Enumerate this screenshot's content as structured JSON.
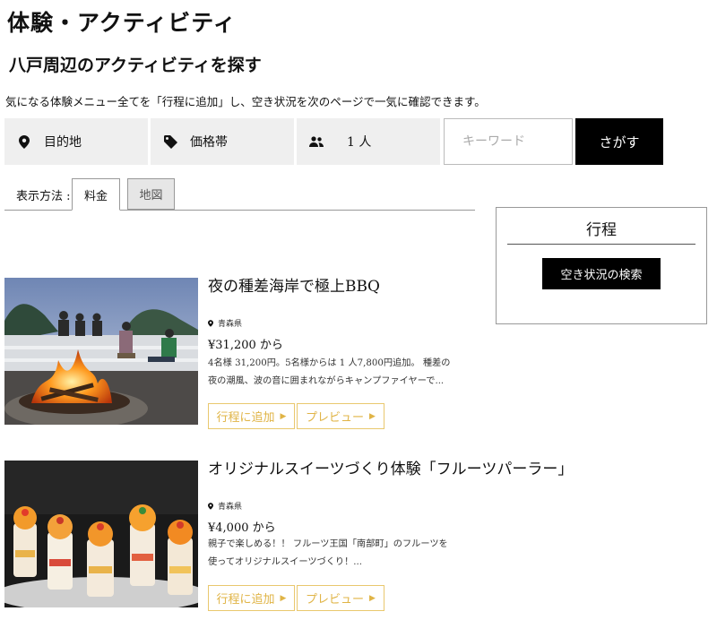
{
  "header": {
    "title": "体験・アクティビティ",
    "subtitle": "八戸周辺のアクティビティを探す",
    "intro": "気になる体験メニュー全てを「行程に追加」し、空き状況を次のページで一気に確認できます。"
  },
  "filters": {
    "destination": "目的地",
    "price_band": "価格帯",
    "people": "1 人",
    "keyword_placeholder": "キーワード",
    "search_label": "さがす"
  },
  "view": {
    "label": "表示方法 :",
    "tabs": [
      {
        "label": "料金",
        "active": true
      },
      {
        "label": "地図",
        "active": false
      }
    ]
  },
  "itinerary": {
    "title": "行程",
    "check_label": "空き状況の検索"
  },
  "activities": [
    {
      "title": "夜の種差海岸で極上BBQ",
      "location": "青森県",
      "price": "¥31,200 から",
      "desc": "4名様 31,200円。5名様からは 1 人7,800円追加。 種差の夜の潮風、波の音に囲まれながらキャンプファイヤーで...",
      "add_label": "行程に追加",
      "preview_label": "プレビュー",
      "image": "campfire-photo"
    },
    {
      "title": "オリジナルスイーツづくり体験「フルーツパーラー」",
      "location": "青森県",
      "price": "¥4,000 から",
      "desc": "親子で楽しめる！！ フルーツ王国「南部町」のフルーツを使ってオリジナルスイーツづくり！...",
      "add_label": "行程に追加",
      "preview_label": "プレビュー",
      "image": "fruit-parfait-photo"
    }
  ],
  "colors": {
    "accent_gold": "#e0b446",
    "search_bg": "#000000",
    "filter_bg": "#efefef"
  }
}
